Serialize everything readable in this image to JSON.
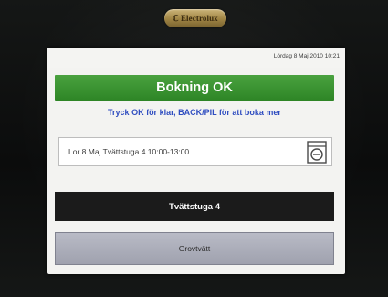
{
  "brand": {
    "logo_text": "ℂ Electrolux"
  },
  "status_bar": {
    "datetime": "Lördag 8 Maj 2010  10:21"
  },
  "header": {
    "title": "Bokning OK"
  },
  "instruction": {
    "text": "Tryck OK för klar, BACK/PIL för att boka mer"
  },
  "booking": {
    "summary": "Lor 8 Maj  Tvättstuga 4  10:00-13:00",
    "icon": "washing-machine-icon"
  },
  "buttons": {
    "room_label": "Tvättstuga 4",
    "option_label": "Grovtvätt"
  },
  "colors": {
    "header_green": "#3a9632",
    "instruction_blue": "#2f4dc0",
    "room_button_bg": "#1b1b1b",
    "option_button_bg": "#aeb0bc",
    "logo_gold": "#b8994f"
  }
}
